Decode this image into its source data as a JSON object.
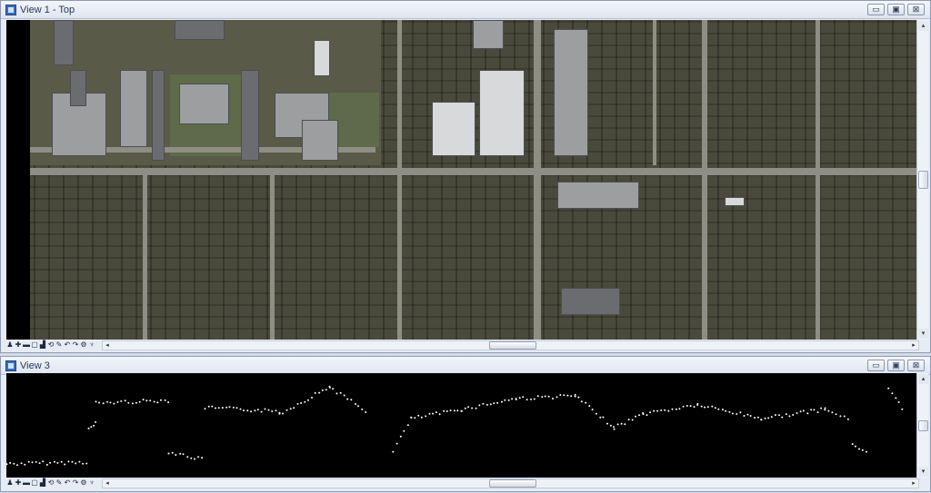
{
  "windows": [
    {
      "title": "View 1 - Top",
      "controls": {
        "minimize": "▭",
        "restore": "▣",
        "close": "⊠"
      }
    },
    {
      "title": "View 3",
      "controls": {
        "minimize": "▭",
        "restore": "▣",
        "close": "⊠"
      }
    }
  ],
  "view_tools": [
    {
      "name": "view-attributes-icon",
      "glyph": "♟"
    },
    {
      "name": "zoom-in-icon",
      "glyph": "✚"
    },
    {
      "name": "zoom-out-icon",
      "glyph": "▬"
    },
    {
      "name": "window-area-icon",
      "glyph": "▢"
    },
    {
      "name": "fit-view-icon",
      "glyph": "▟"
    },
    {
      "name": "rotate-view-icon",
      "glyph": "⟲"
    },
    {
      "name": "pan-view-icon",
      "glyph": "✎"
    },
    {
      "name": "view-previous-icon",
      "glyph": "↶"
    },
    {
      "name": "view-next-icon",
      "glyph": "↷"
    },
    {
      "name": "view-settings-icon",
      "glyph": "⚙"
    },
    {
      "name": "view-display-mode-icon",
      "glyph": "♆"
    }
  ],
  "scroll": {
    "left": "◂",
    "right": "▸",
    "up": "▴",
    "down": "▾"
  },
  "colors": {
    "background": "#000000",
    "points": "#ffffff",
    "frame": "#e7ebf3"
  }
}
